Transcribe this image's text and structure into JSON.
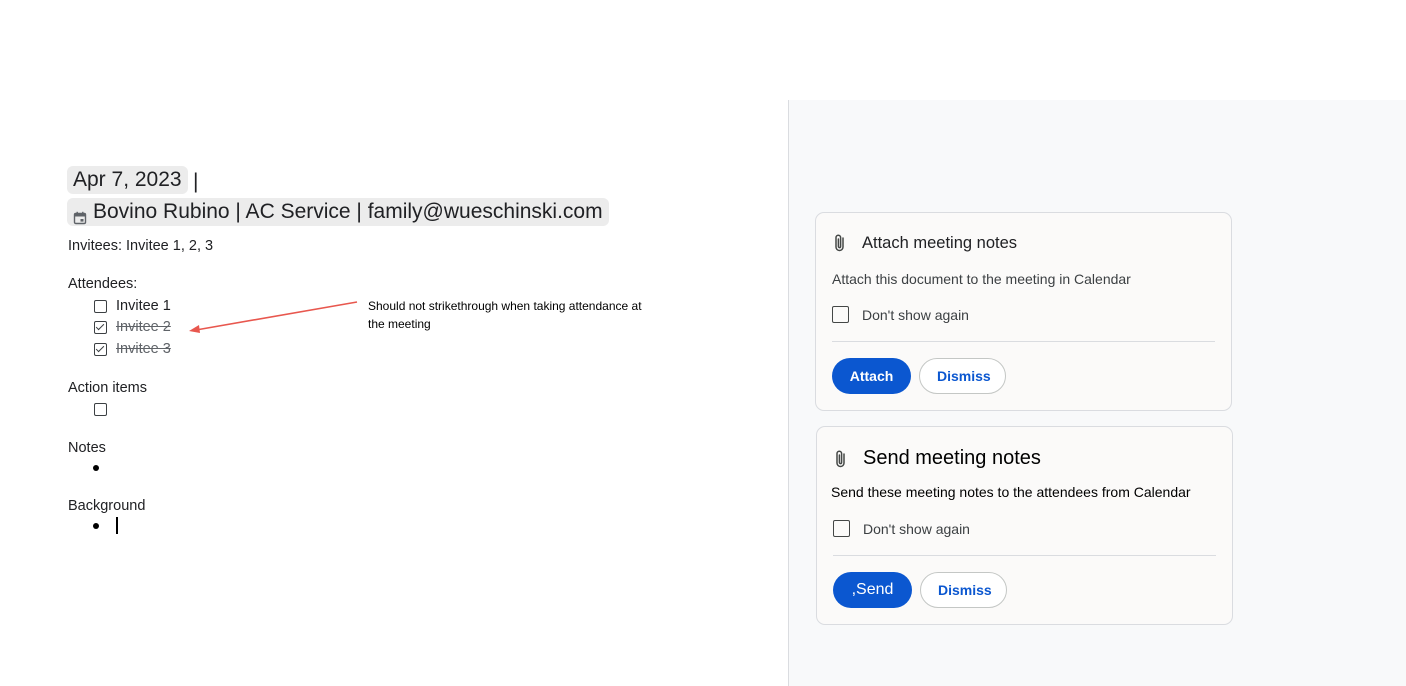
{
  "document": {
    "date_chip": "Apr 7, 2023",
    "separator": "|",
    "event_chip": "Bovino Rubino | AC Service | family@wueschinski.com",
    "invitees_line": "Invitees: Invitee 1, 2, 3",
    "attendees_heading": "Attendees:",
    "attendees": [
      {
        "label": "Invitee 1",
        "checked": false
      },
      {
        "label": "Invitee 2",
        "checked": true
      },
      {
        "label": "Invitee 3",
        "checked": true
      }
    ],
    "action_items_heading": "Action items",
    "notes_heading": "Notes",
    "background_heading": "Background"
  },
  "annotation": {
    "text": "Should not strikethrough when taking attendance at the meeting",
    "arrow_color": "#e8574e"
  },
  "panel": {
    "attach_card": {
      "title": "Attach meeting notes",
      "description": "Attach this document to the meeting in Calendar",
      "dont_show_label": "Don't show again",
      "primary_label": "Attach",
      "dismiss_label": "Dismiss"
    },
    "send_card": {
      "title": "Send meeting notes",
      "description": "Send these meeting notes to the attendees from Calendar",
      "dont_show_label": "Don't show again",
      "primary_label": ",Send",
      "dismiss_label": "Dismiss"
    },
    "accent_color": "#0b57d0"
  }
}
